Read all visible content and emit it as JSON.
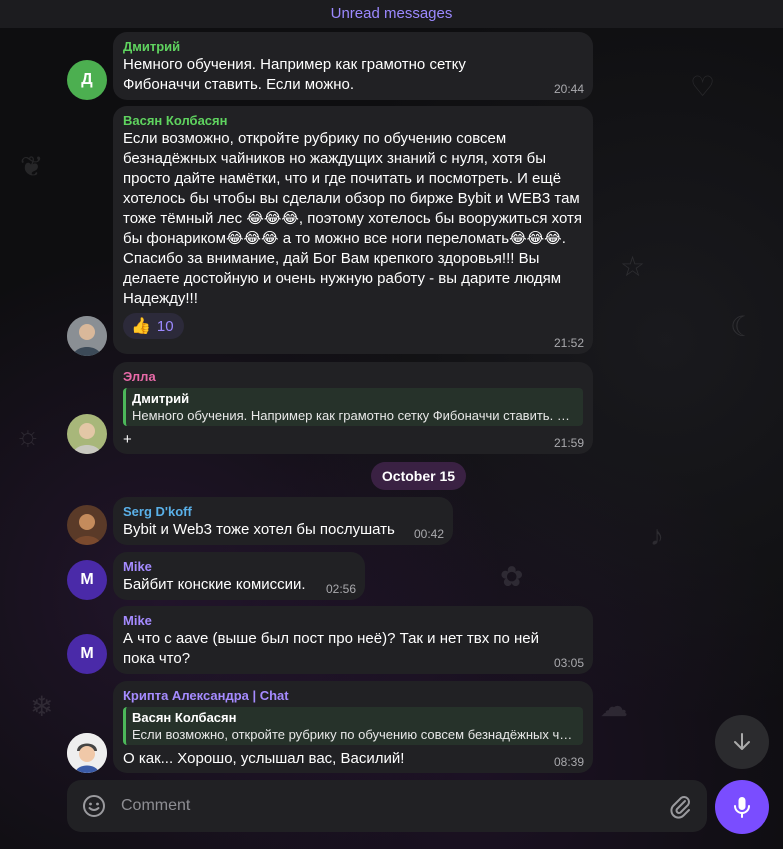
{
  "header": {
    "unread_label": "Unread messages"
  },
  "date_chip": "October 15",
  "messages": [
    {
      "sender": "Дмитрий",
      "sender_color": "#5fd35f",
      "avatar_letter": "Д",
      "avatar_color": "#4caf50",
      "text": "Немного обучения. Например как грамотно сетку Фибоначчи ставить. Если можно.",
      "time": "20:44"
    },
    {
      "sender": "Васян Колбасян",
      "sender_color": "#5fd35f",
      "text": "Если возможно, откройте рубрику по обучению совсем безнадёжных чайников но жаждущих знаний с нуля, хотя бы просто дайте намётки, что и где почитать и посмотреть. И ещё хотелось бы чтобы вы сделали обзор по бирже Bybit и WEB3 там тоже тёмный лес 😂😂😂, поэтому хотелось бы вооружиться хотя бы фонариком😂😂😂 а то можно все ноги переломать😂😂😂. Спасибо за внимание, дай Бог Вам крепкого здоровья!!! Вы делаете достойную и очень нужную работу - вы дарите людям Надежду!!!",
      "reaction_emoji": "👍",
      "reaction_count": "10",
      "time": "21:52"
    },
    {
      "sender": "Элла",
      "sender_color": "#e86aa8",
      "reply_name": "Дмитрий",
      "reply_text": "Немного обучения. Например как грамотно сетку Фибоначчи ставить. Если можно.",
      "text": "+",
      "time": "21:59"
    },
    {
      "sender": "Serg D'koff",
      "sender_color": "#5ab0e8",
      "text": "Bybit и Web3 тоже хотел бы послушать",
      "time": "00:42"
    },
    {
      "sender": "Mike",
      "sender_color": "#a58bff",
      "avatar_letter": "M",
      "avatar_color": "#4a2aa8",
      "text": "Байбит конские комиссии.",
      "time": "02:56"
    },
    {
      "sender": "Mike",
      "sender_color": "#a58bff",
      "avatar_letter": "M",
      "avatar_color": "#4a2aa8",
      "text": "А что с aave (выше был пост про неё)? Так и нет твх по ней пока что?",
      "time": "03:05"
    },
    {
      "sender": "Крипта Александра | Chat",
      "sender_color": "#a58bff",
      "reply_name": "Васян Колбасян",
      "reply_text": "Если возможно, откройте рубрику по обучению совсем безнадёжных чайников но жаждущих знаний с нуля",
      "text": "О как... Хорошо, услышал вас, Василий!",
      "time": "08:39"
    }
  ],
  "composer": {
    "placeholder": "Comment"
  },
  "icons": {
    "emoji": "smile-icon",
    "attach": "paperclip-icon",
    "mic": "microphone-icon",
    "scroll": "chevron-down-icon"
  },
  "colors": {
    "accent": "#7a4dff",
    "bubble": "#212124",
    "background": "#0e0e10"
  }
}
